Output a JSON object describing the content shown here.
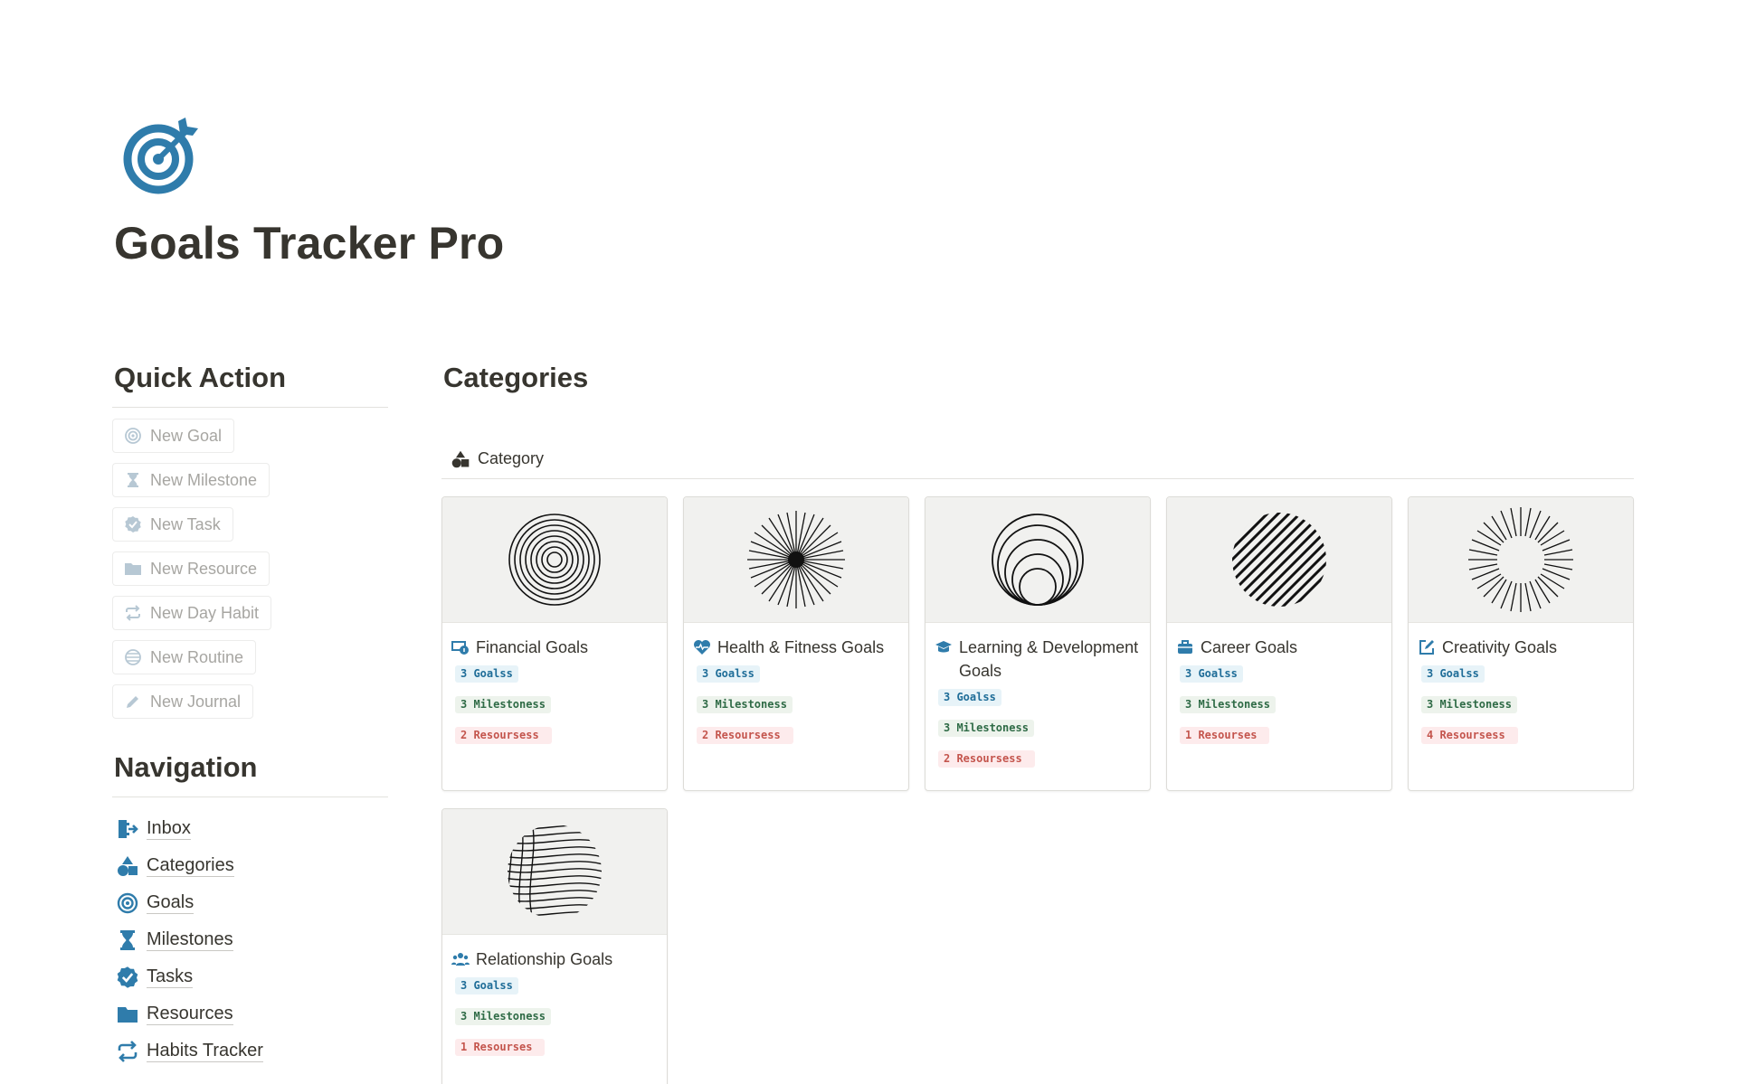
{
  "page": {
    "title": "Goals Tracker Pro",
    "icon": "target-icon"
  },
  "colors": {
    "accent": "#2f7cab",
    "blue_tag_bg": "#e7f3f8",
    "green_tag_bg": "#edf3ec",
    "red_tag_bg": "#fdebec"
  },
  "quick_action": {
    "heading": "Quick Action",
    "buttons": [
      {
        "label": "New Goal",
        "icon": "target-icon"
      },
      {
        "label": "New Milestone",
        "icon": "hourglass-icon"
      },
      {
        "label": "New Task",
        "icon": "verified-check-icon"
      },
      {
        "label": "New Resource",
        "icon": "folder-icon"
      },
      {
        "label": "New Day Habit",
        "icon": "repeat-icon"
      },
      {
        "label": "New Routine",
        "icon": "globe-icon"
      },
      {
        "label": "New Journal",
        "icon": "pencil-icon"
      }
    ]
  },
  "navigation": {
    "heading": "Navigation",
    "items": [
      {
        "label": "Inbox",
        "icon": "inbox-icon"
      },
      {
        "label": "Categories",
        "icon": "shapes-icon"
      },
      {
        "label": "Goals",
        "icon": "target-icon"
      },
      {
        "label": "Milestones",
        "icon": "hourglass-icon"
      },
      {
        "label": "Tasks",
        "icon": "verified-check-icon"
      },
      {
        "label": "Resources",
        "icon": "folder-icon"
      },
      {
        "label": "Habits Tracker",
        "icon": "repeat-icon"
      }
    ]
  },
  "categories": {
    "heading": "Categories",
    "view_tab": "Category",
    "cards": [
      {
        "title": "Financial Goals",
        "icon": "money-icon",
        "cover": "concentric-circles",
        "goals": "3 Goalss",
        "milestones": "3 Milestoness",
        "resources": "2 Resoursess"
      },
      {
        "title": "Health & Fitness Goals",
        "icon": "heart-pulse-icon",
        "cover": "starburst",
        "goals": "3 Goalss",
        "milestones": "3 Milestoness",
        "resources": "2 Resoursess"
      },
      {
        "title": "Learning & Development Goals",
        "icon": "graduation-cap-icon",
        "cover": "nested-circles",
        "goals": "3 Goalss",
        "milestones": "3 Milestoness",
        "resources": "2 Resoursess"
      },
      {
        "title": "Career Goals",
        "icon": "briefcase-icon",
        "cover": "hatched-circle",
        "goals": "3 Goalss",
        "milestones": "3 Milestoness",
        "resources": "1 Resourses"
      },
      {
        "title": "Creativity Goals",
        "icon": "edit-square-icon",
        "cover": "radial-lines",
        "goals": "3 Goalss",
        "milestones": "3 Milestoness",
        "resources": "4 Resoursess"
      },
      {
        "title": "Relationship Goals",
        "icon": "people-icon",
        "cover": "wave-sphere",
        "goals": "3 Goalss",
        "milestones": "3 Milestoness",
        "resources": "1 Resourses"
      }
    ]
  }
}
